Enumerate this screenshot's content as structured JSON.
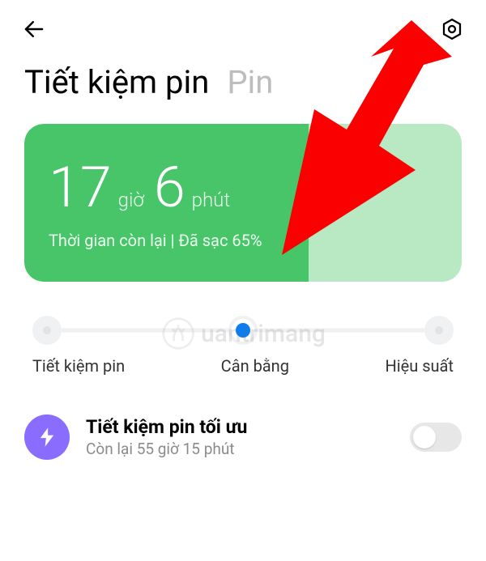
{
  "tabs": {
    "saver": "Tiết kiệm pin",
    "battery": "Pin"
  },
  "card": {
    "hours": "17",
    "hours_unit": "giờ",
    "minutes": "6",
    "minutes_unit": "phút",
    "subtitle": "Thời gian còn lại | Đã sạc 65%"
  },
  "slider": {
    "left": "Tiết kiệm pin",
    "center": "Cân bằng",
    "right": "Hiệu suất"
  },
  "ultra": {
    "title": "Tiết kiệm pin tối ưu",
    "subtitle": "Còn lại 55 giờ 15 phút"
  },
  "watermark": "uantrimang"
}
